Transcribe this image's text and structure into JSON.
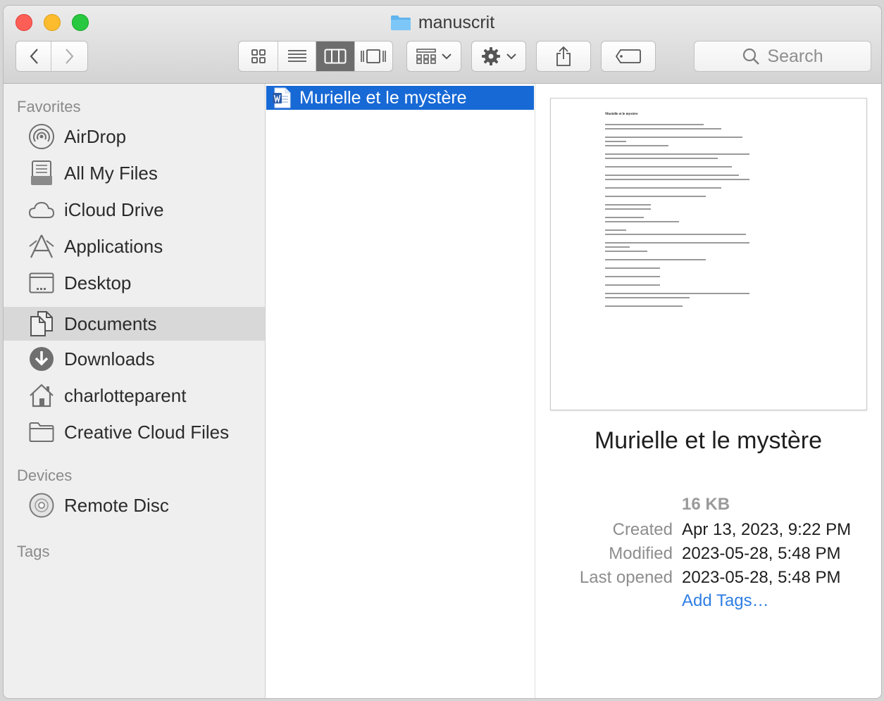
{
  "window": {
    "title": "manuscrit"
  },
  "toolbar": {
    "back_icon": "chevron-left-icon",
    "forward_icon": "chevron-right-icon",
    "view_modes": [
      "icon-view",
      "list-view",
      "column-view",
      "gallery-view"
    ],
    "active_view": "column-view",
    "search_placeholder": "Search"
  },
  "sidebar": {
    "favorites_label": "Favorites",
    "favorites": [
      {
        "label": "AirDrop",
        "icon": "airdrop-icon"
      },
      {
        "label": "All My Files",
        "icon": "all-my-files-icon"
      },
      {
        "label": "iCloud Drive",
        "icon": "cloud-icon"
      },
      {
        "label": "Applications",
        "icon": "applications-icon"
      },
      {
        "label": "Desktop",
        "icon": "desktop-icon"
      },
      {
        "label": "Documents",
        "icon": "documents-icon",
        "selected": true
      },
      {
        "label": "Downloads",
        "icon": "downloads-icon"
      },
      {
        "label": "charlotteparent",
        "icon": "home-icon"
      },
      {
        "label": "Creative Cloud Files",
        "icon": "folder-icon"
      }
    ],
    "devices_label": "Devices",
    "devices": [
      {
        "label": "Remote Disc",
        "icon": "disc-icon"
      }
    ],
    "tags_label": "Tags"
  },
  "column": {
    "selected_file": "Murielle et le mystère",
    "file_icon": "word-document-icon"
  },
  "preview": {
    "thumbnail_title": "Murielle et le mystère",
    "name": "Murielle et le mystère",
    "size": "16 KB",
    "created_label": "Created",
    "created_value": "Apr 13, 2023, 9:22 PM",
    "modified_label": "Modified",
    "modified_value": "2023-05-28, 5:48 PM",
    "last_opened_label": "Last opened",
    "last_opened_value": "2023-05-28, 5:48 PM",
    "add_tags": "Add Tags…"
  },
  "colors": {
    "selection": "#1769d5",
    "link": "#2f7ee4",
    "sidebar_bg": "#efefef"
  }
}
